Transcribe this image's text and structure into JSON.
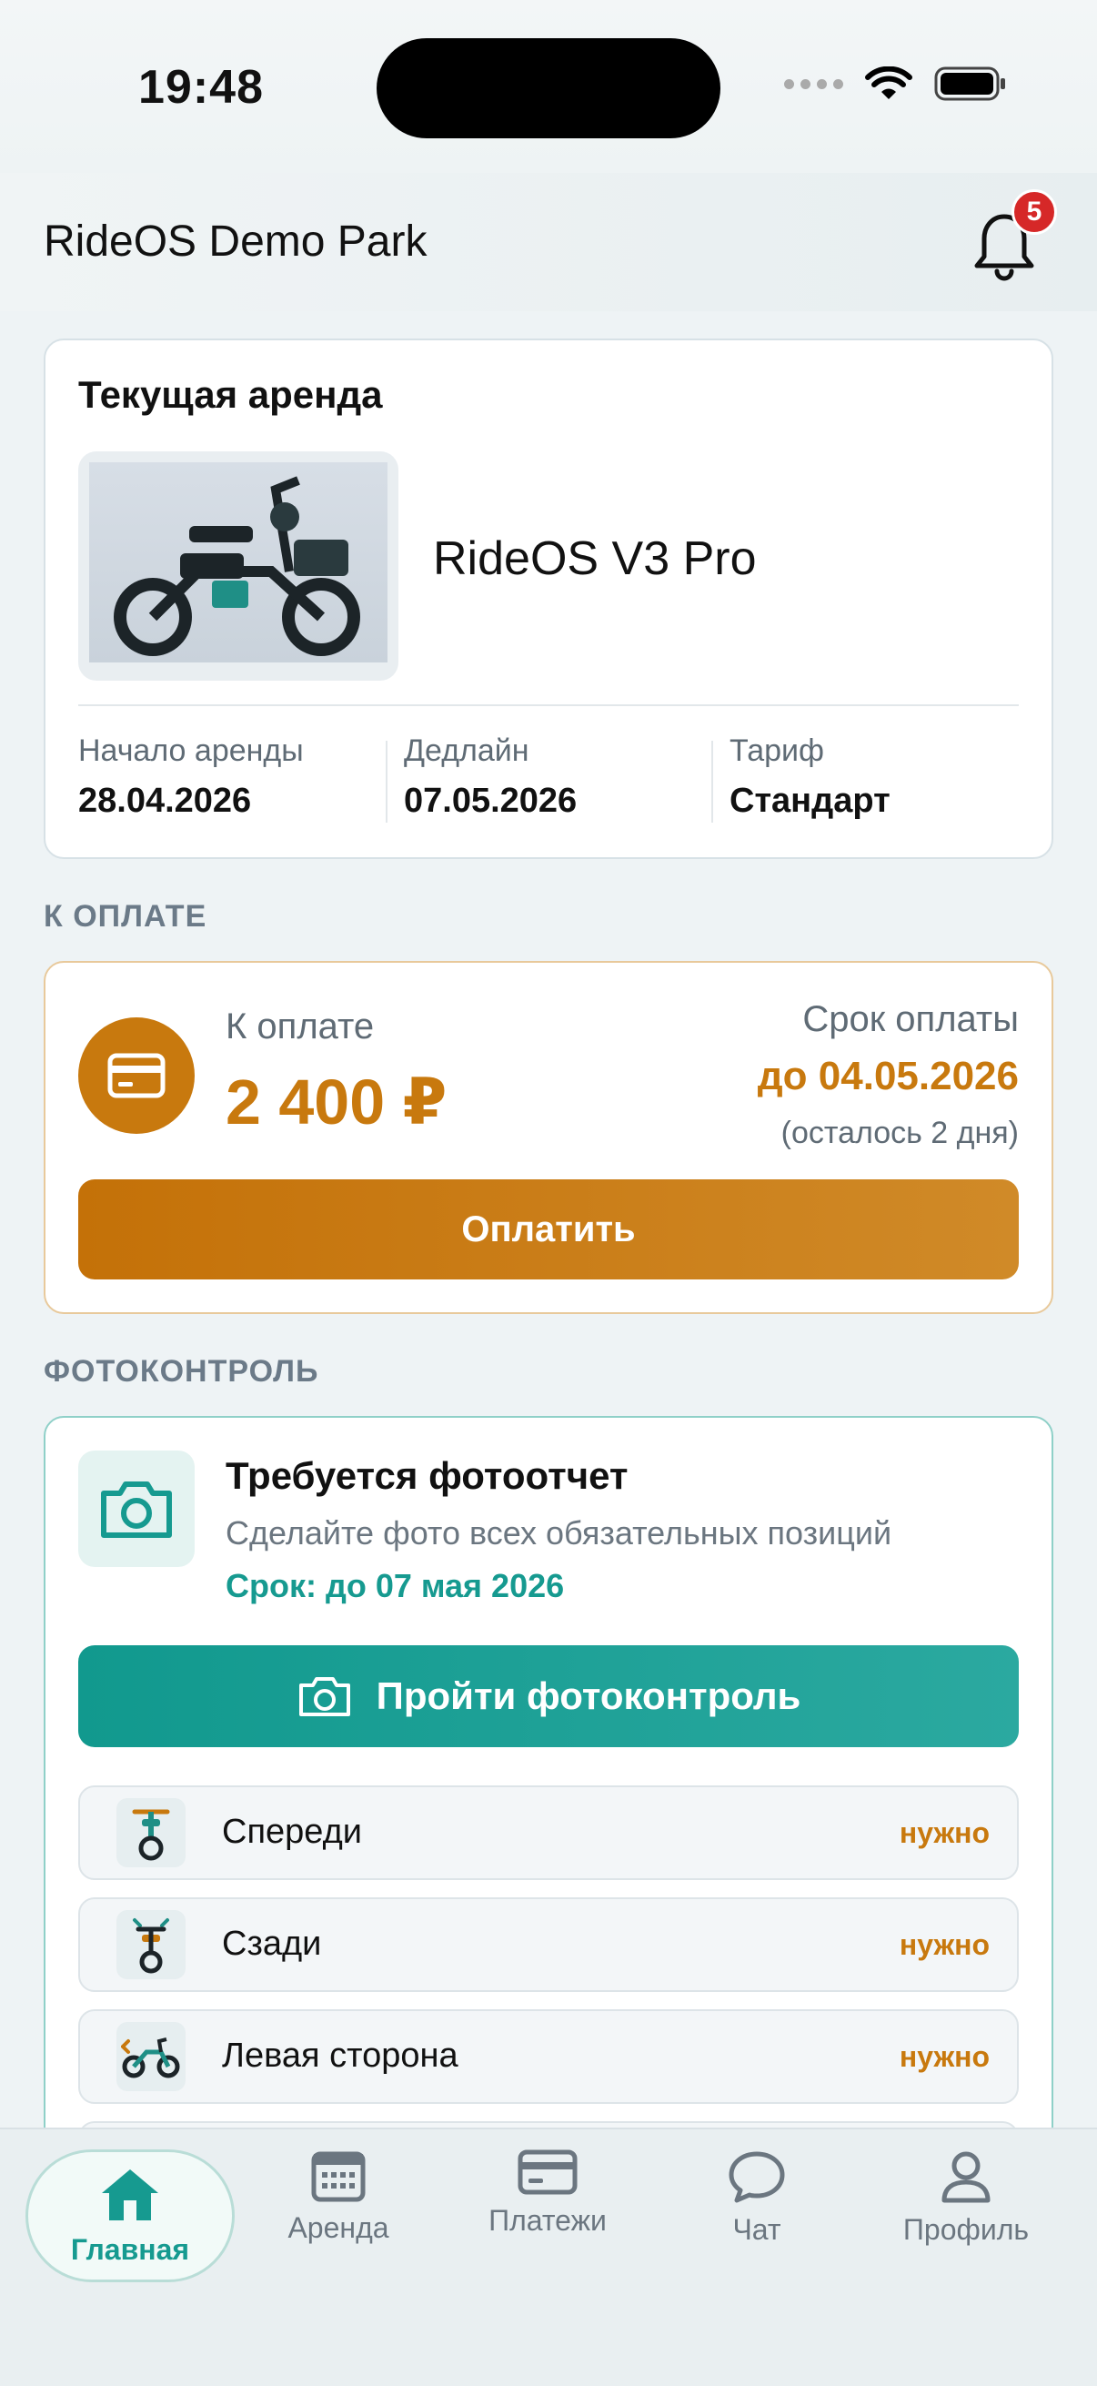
{
  "status_bar": {
    "time": "19:48"
  },
  "header": {
    "title": "RideOS Demo Park",
    "notifications_count": "5"
  },
  "rental": {
    "title": "Текущая аренда",
    "model": "RideOS V3 Pro",
    "start_label": "Начало аренды",
    "start_value": "28.04.2026",
    "deadline_label": "Дедлайн",
    "deadline_value": "07.05.2026",
    "tariff_label": "Тариф",
    "tariff_value": "Стандарт"
  },
  "payment_section": {
    "label": "К ОПЛАТЕ",
    "amount_label": "К оплате",
    "amount": "2 400 ₽",
    "due_label": "Срок оплаты",
    "due_date": "до 04.05.2026",
    "due_left": "(осталось 2 дня)",
    "pay_button": "Оплатить"
  },
  "photo_section": {
    "label": "ФОТОКОНТРОЛЬ",
    "title": "Требуется фотоотчет",
    "subtitle": "Сделайте фото всех обязательных позиций",
    "deadline": "Срок: до 07 мая 2026",
    "button": "Пройти фотоконтроль",
    "positions": [
      {
        "label": "Спереди",
        "status": "нужно"
      },
      {
        "label": "Сзади",
        "status": "нужно"
      },
      {
        "label": "Левая сторона",
        "status": "нужно"
      }
    ]
  },
  "tabs": [
    {
      "label": "Главная",
      "active": true
    },
    {
      "label": "Аренда"
    },
    {
      "label": "Платежи"
    },
    {
      "label": "Чат"
    },
    {
      "label": "Профиль"
    }
  ],
  "colors": {
    "accent_orange": "#c8790e",
    "accent_teal": "#169a90"
  }
}
